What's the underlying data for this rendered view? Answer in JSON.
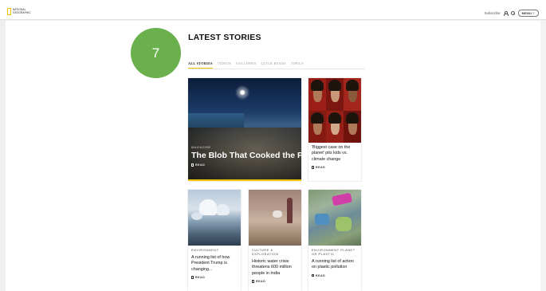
{
  "header": {
    "logo_line1": "NATIONAL",
    "logo_line2": "GEOGRAPHIC",
    "subscribe_label": "Subscribe",
    "menu_label": "MENU ≡"
  },
  "step_badge": "7",
  "section": {
    "title": "LATEST STORIES",
    "tabs": [
      {
        "label": "ALL STORIES",
        "active": true
      },
      {
        "label": "VIDEOS",
        "active": false
      },
      {
        "label": "GALLERIES",
        "active": false
      },
      {
        "label": "QUICK READS",
        "active": false
      },
      {
        "label": "TOPICS",
        "active": false
      }
    ]
  },
  "cards": {
    "feature": {
      "kicker": "MAGAZINE",
      "title": "The Blob That Cooked the Pacific",
      "read": "READ"
    },
    "faces": {
      "kicker": "",
      "title": "'Biggest case on the planet' pits kids vs. climate change",
      "read": "READ"
    },
    "c1": {
      "kicker": "ENVIRONMENT",
      "title": "A running list of how President Trump is changing...",
      "read": "READ"
    },
    "c2": {
      "kicker": "CULTURE & EXPLORATION",
      "title": "Historic water crisis threatens 600 million people in India",
      "read": "READ"
    },
    "c3": {
      "kicker": "ENVIRONMENT PLANET OR PLASTIC",
      "title": "A running list of action on plastic pollution",
      "read": "READ"
    }
  },
  "colors": {
    "accent": "#f2c300",
    "badge": "#6ab04c"
  }
}
